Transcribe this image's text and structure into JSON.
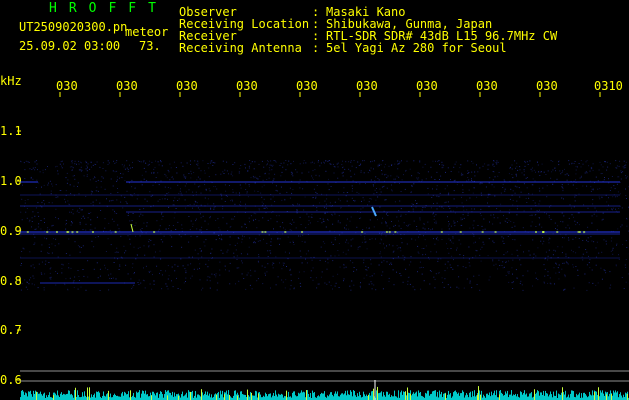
{
  "header": {
    "title": "HROFFT",
    "filename": "UT2509020300.pn",
    "meteor_label": "meteor",
    "datetime": "25.09.02 03:00",
    "count": "73."
  },
  "info": [
    {
      "label": "Observer",
      "value": "Masaki Kano"
    },
    {
      "label": "Receiving Location",
      "value": "Shibukawa, Gunma, Japan"
    },
    {
      "label": "Receiver",
      "value": "RTL-SDR SDR# 43dB L15 96.7MHz CW"
    },
    {
      "label": "Receiving Antenna",
      "value": "5el Yagi Az 280 for Seoul"
    }
  ],
  "axis": {
    "unit": "kHz",
    "time_ticks": [
      "030",
      "030",
      "030",
      "030",
      "030",
      "030",
      "030",
      "030",
      "030",
      "0310"
    ],
    "freq_ticks": [
      "1.1",
      "1.0",
      "0.9",
      "0.8",
      "0.7",
      "0.6"
    ]
  },
  "colors": {
    "background": "#000000",
    "text": "#ffff00",
    "title": "#00ff00",
    "signal": "#2a3cff",
    "bright_signal": "#c8ff3c",
    "bottom_band": "#00c8c8"
  }
}
